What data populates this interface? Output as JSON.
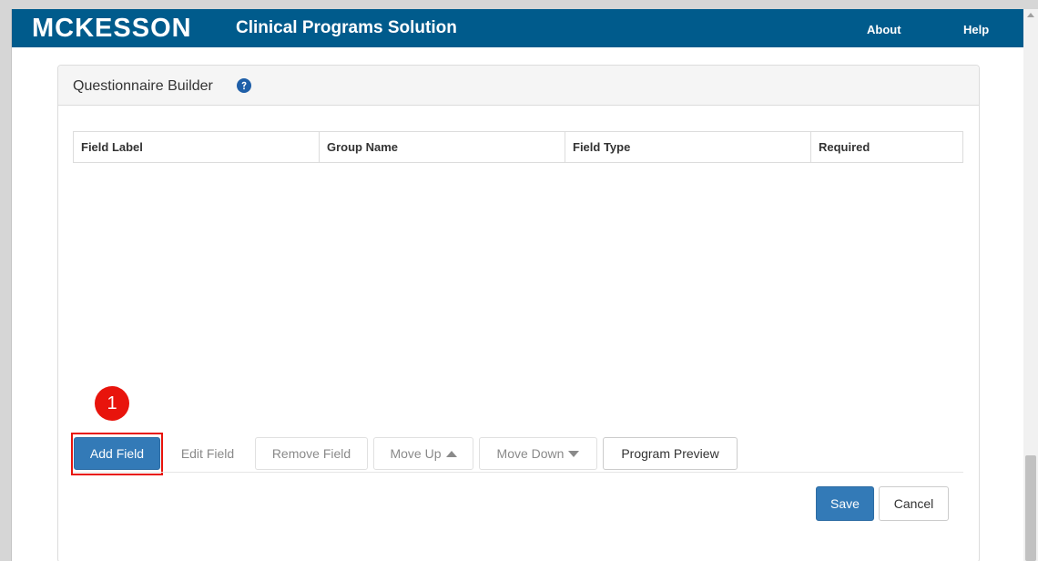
{
  "header": {
    "logo": "MCKESSON",
    "title": "Clinical Programs Solution",
    "nav": {
      "about": "About",
      "help": "Help"
    }
  },
  "panel": {
    "title": "Questionnaire Builder",
    "help_icon": "question-circle-icon",
    "table": {
      "columns": [
        "Field Label",
        "Group Name",
        "Field Type",
        "Required"
      ],
      "rows": []
    }
  },
  "annotation": {
    "step": "1"
  },
  "toolbar": {
    "add_field": "Add Field",
    "edit_field": "Edit Field",
    "remove_field": "Remove Field",
    "move_up": "Move Up",
    "move_down": "Move Down",
    "program_preview": "Program Preview"
  },
  "footer": {
    "save": "Save",
    "cancel": "Cancel"
  },
  "colors": {
    "header_bg": "#005b8c",
    "primary_button": "#337ab7",
    "highlight": "#e8140c"
  }
}
